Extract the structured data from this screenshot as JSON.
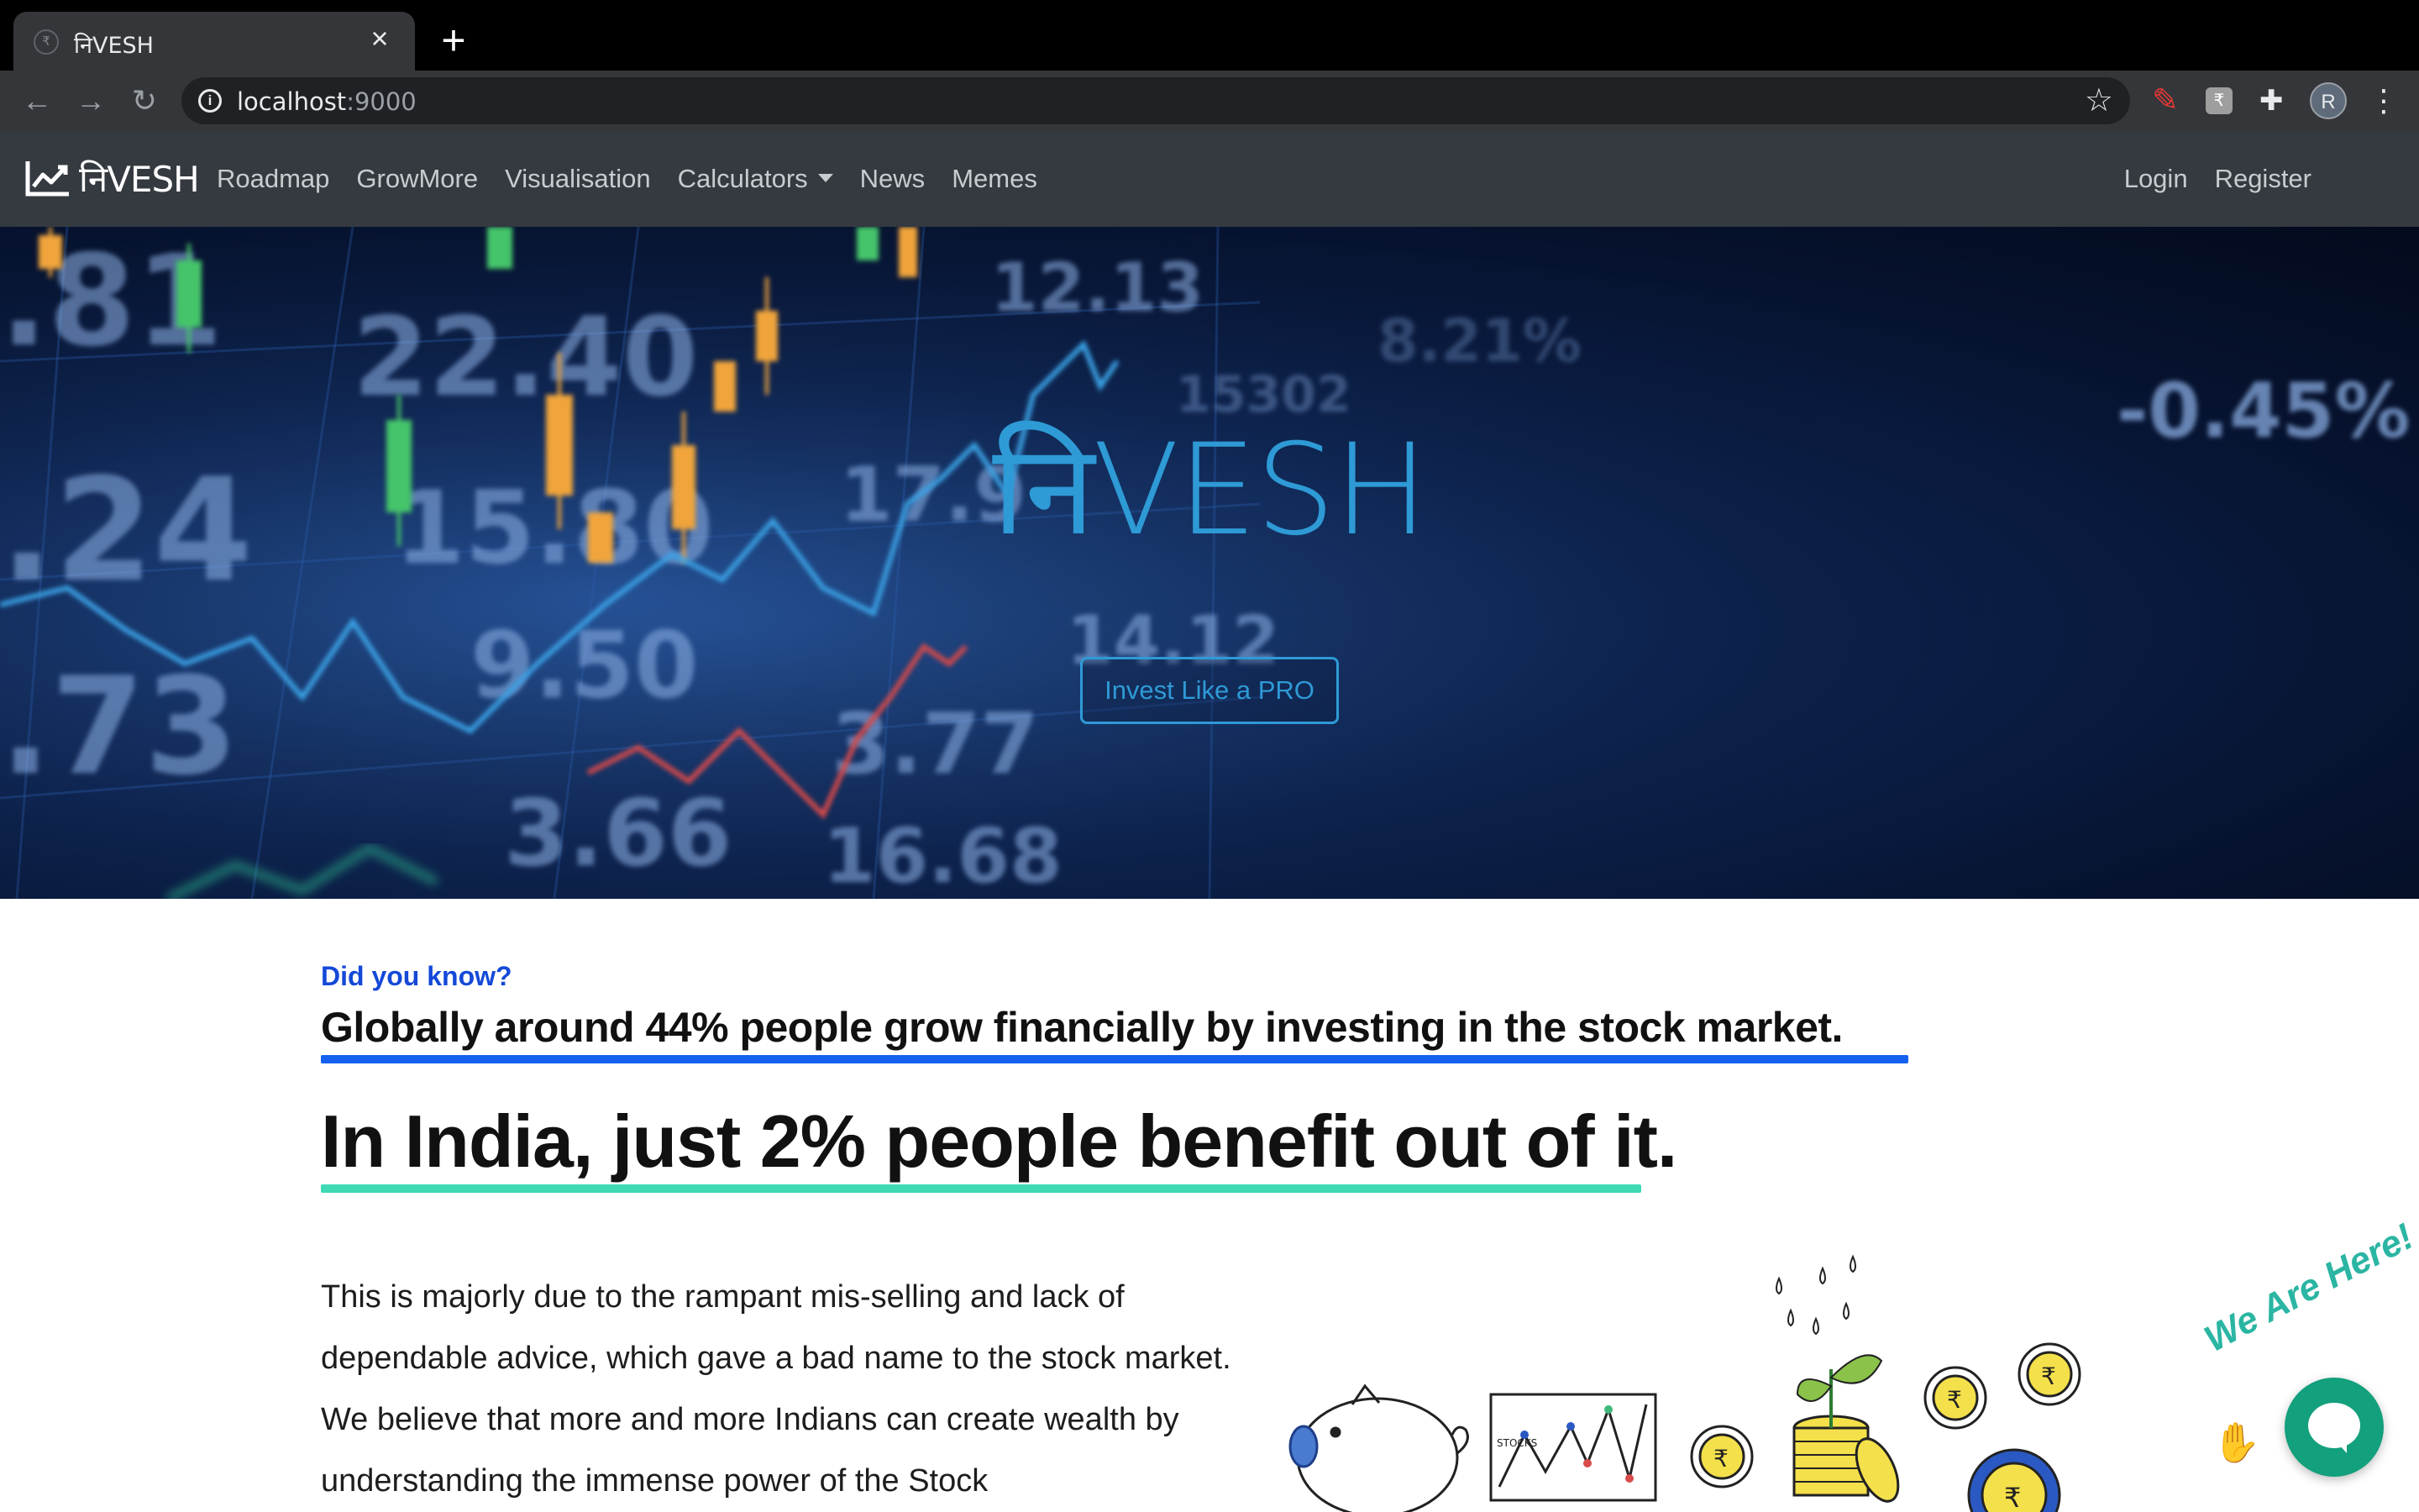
{
  "browser": {
    "tab_title": "निVESH",
    "tab_close": "×",
    "new_tab": "+",
    "url_host": "localhost",
    "url_port": ":9000",
    "profile_initial": "R"
  },
  "navbar": {
    "brand": "निVESH",
    "links": [
      "Roadmap",
      "GrowMore",
      "Visualisation",
      "Calculators",
      "News",
      "Memes"
    ],
    "right_links": [
      "Login",
      "Register"
    ]
  },
  "hero": {
    "title": "निVESH",
    "cta": "Invest Like a PRO"
  },
  "content": {
    "eyebrow": "Did you know?",
    "headline1": "Globally around 44% people grow financially by investing in the stock market.",
    "headline2": "In India, just 2% people benefit out of it.",
    "body": "This is majorly due to the rampant mis-selling and lack of dependable advice, which gave a bad name to the stock market. We believe that more and more Indians can create wealth by understanding the immense power of the Stock"
  },
  "chat": {
    "label": "We Are Here!"
  },
  "colors": {
    "accent_blue": "#1461f0",
    "accent_green": "#3fd9b4",
    "hero_title": "#2e9ad6",
    "navbar_bg": "#343a40",
    "chat_green": "#13a07c"
  }
}
